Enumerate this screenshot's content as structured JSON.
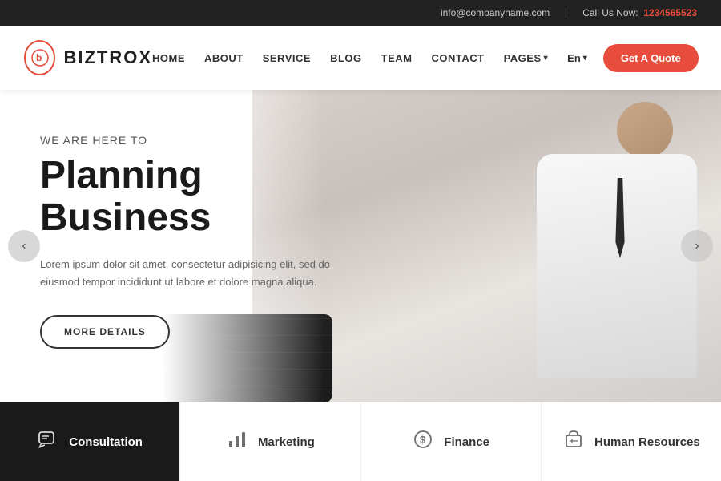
{
  "topbar": {
    "email": "info@companyname.com",
    "call_label": "Call Us Now:",
    "phone": "1234565523"
  },
  "header": {
    "logo_text": "BIZTROX",
    "logo_icon": "b",
    "nav": {
      "home": "HOME",
      "about": "ABOUT",
      "service": "SERVICE",
      "blog": "BLOG",
      "team": "TEAM",
      "contact": "CONTACT",
      "pages": "PAGES",
      "lang": "En"
    },
    "quote_btn": "Get A Quote"
  },
  "hero": {
    "subtitle": "WE ARE HERE TO",
    "title": "Planning Business",
    "desc": "Lorem ipsum dolor sit amet, consectetur adipisicing elit, sed do eiusmod tempor incididunt ut labore et dolore magna aliqua.",
    "btn": "MORE DETAILS",
    "arrow_left": "‹",
    "arrow_right": "›"
  },
  "services": [
    {
      "id": "consultation",
      "label": "Consultation",
      "icon": "chat"
    },
    {
      "id": "marketing",
      "label": "Marketing",
      "icon": "chart"
    },
    {
      "id": "finance",
      "label": "Finance",
      "icon": "dollar"
    },
    {
      "id": "human-resources",
      "label": "Human Resources",
      "icon": "box"
    }
  ]
}
